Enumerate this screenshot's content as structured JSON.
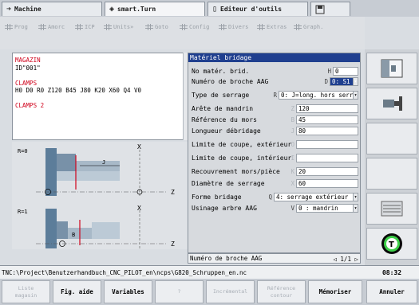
{
  "tabs": [
    {
      "label": "Machine",
      "icon": "arrow-right-icon"
    },
    {
      "label": "smart.Turn",
      "icon": "diamond-arrows-icon"
    },
    {
      "label": "Editeur d'outils",
      "icon": "tool-editor-icon"
    },
    {
      "label": "",
      "icon": "save-icon"
    }
  ],
  "menu": [
    "Prog",
    "Amorc",
    "ICP",
    "Units»",
    "Goto",
    "Config",
    "Divers",
    "Extras",
    "Graph."
  ],
  "program": [
    {
      "text": "MAGAZIN",
      "color": "#d0021b"
    },
    {
      "text": "ID\"001\"",
      "color": "#000000"
    },
    {
      "text": "",
      "color": "#000000"
    },
    {
      "text": "CLAMPS",
      "color": "#d0021b"
    },
    {
      "text": "H0 D0 R0 Z120 B45 J80 K20 X60 Q4 V0",
      "color": "#000000"
    },
    {
      "text": "",
      "color": "#000000"
    },
    {
      "text": "CLAMPS 2",
      "color": "#d0021b"
    }
  ],
  "illustration": {
    "label_r0": "R=0",
    "label_r1": "R=1",
    "axis_x": "X",
    "axis_z": "Z",
    "label_j": "J",
    "label_b": "B"
  },
  "form": {
    "title": "Matériel bridage",
    "rows": [
      {
        "label": "No matér. brid.",
        "letter": "H",
        "value": "0"
      },
      {
        "label": "Numéro de broche AAG",
        "letter": "D",
        "value": "0: S1"
      },
      {
        "label": "Type de serrage",
        "letter": "R",
        "value": "0: J=long. hors serr"
      },
      {
        "label": "Arête de mandrin",
        "letter": "Z",
        "value": "120"
      },
      {
        "label": "Référence du mors",
        "letter": "B",
        "value": "45"
      },
      {
        "label": "Longueur débridage",
        "letter": "J",
        "value": "80"
      },
      {
        "label": "Limite de coupe, extérieur",
        "letter": "O",
        "value": ""
      },
      {
        "label": "Limite de coupe, intérieur",
        "letter": "I",
        "value": ""
      },
      {
        "label": "Recouvrement mors/pièce",
        "letter": "K",
        "value": "20"
      },
      {
        "label": "Diamètre de serrage",
        "letter": "X",
        "value": "60"
      },
      {
        "label": "Forme bridage",
        "letter": "Q",
        "value": "4: serrage extérieur"
      },
      {
        "label": "Usinage arbre AAG",
        "letter": "V",
        "value": "0 : mandrin"
      }
    ],
    "help": "Numéro de broche AAG",
    "page": "1/1"
  },
  "path": "TNC:\\Project\\Benutzerhandbuch_CNC_PILOT_en\\ncps\\G820_Schruppen_en.nc",
  "clock": "08:32",
  "softkeys": [
    {
      "label": "Liste\nmagasin",
      "enabled": false
    },
    {
      "label": "Fig. aide",
      "enabled": true
    },
    {
      "label": "Variables",
      "enabled": true
    },
    {
      "label": "?",
      "enabled": false
    },
    {
      "label": "Incrémental",
      "enabled": false
    },
    {
      "label": "Référence\ncontour",
      "enabled": false
    },
    {
      "label": "Mémoriser",
      "enabled": true
    },
    {
      "label": "Annuler",
      "enabled": true
    }
  ],
  "colors": {
    "accent": "#1f3f8f",
    "red": "#d0021b"
  }
}
